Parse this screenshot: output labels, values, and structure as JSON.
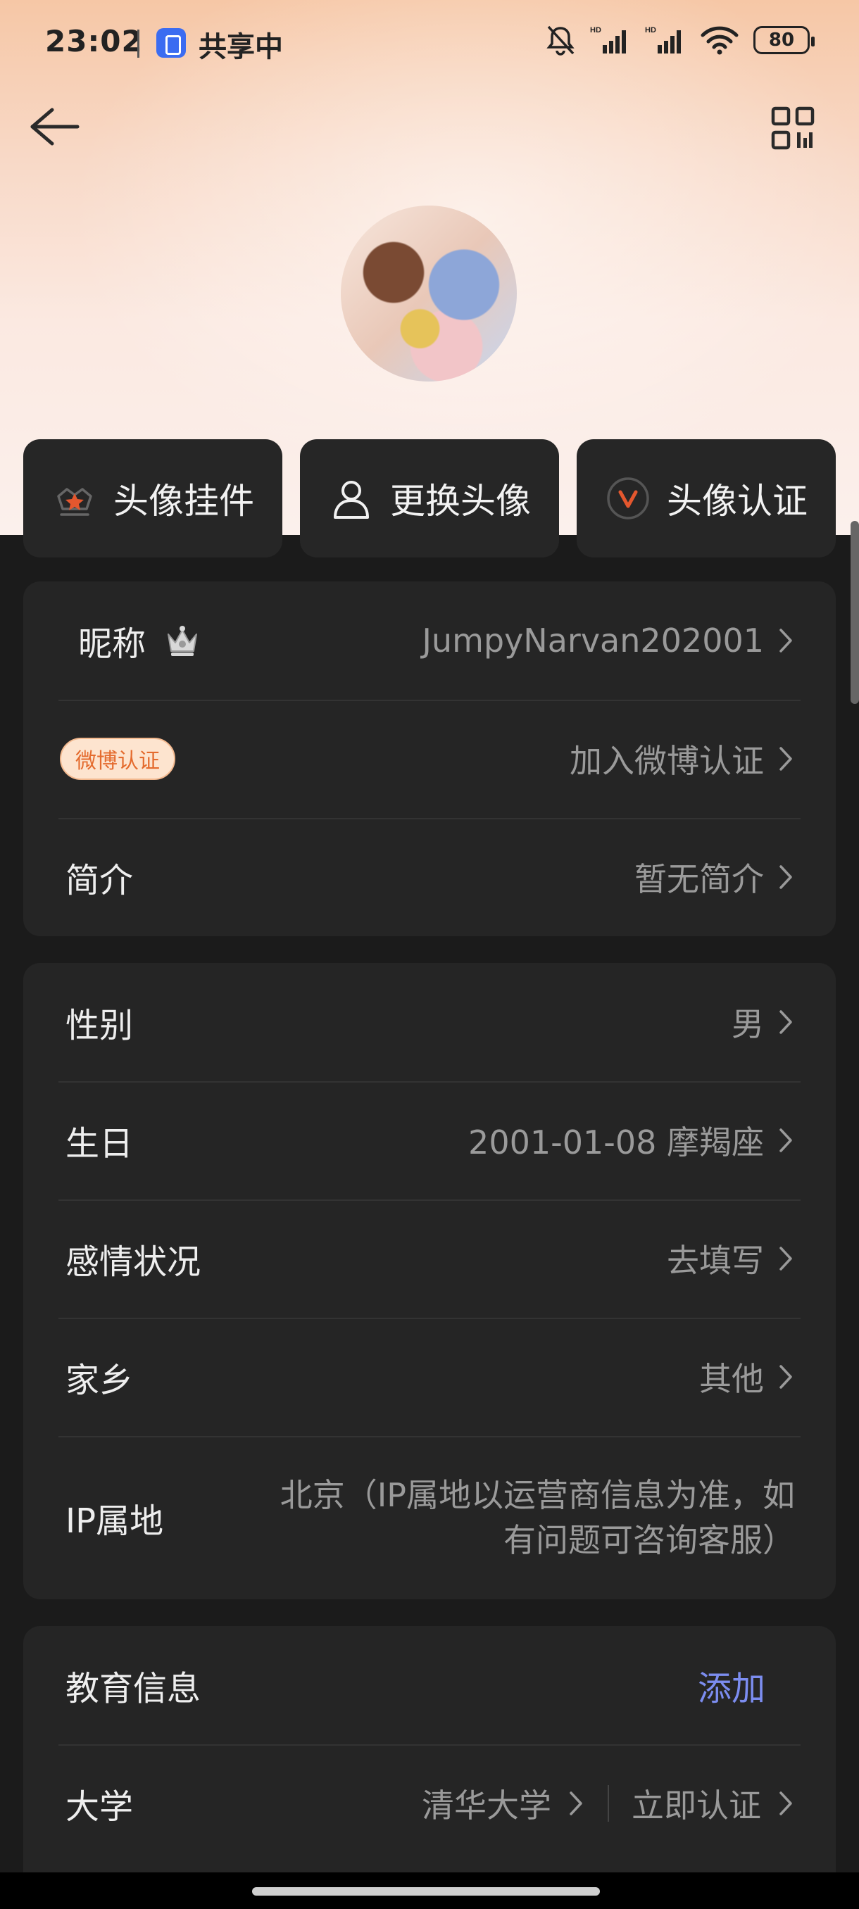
{
  "status_bar": {
    "time": "23:02",
    "share_label": "共享中",
    "battery": "80"
  },
  "action_buttons": [
    {
      "label": "头像挂件",
      "icon": "pendant-icon"
    },
    {
      "label": "更换头像",
      "icon": "person-icon"
    },
    {
      "label": "头像认证",
      "icon": "verified-v-icon"
    }
  ],
  "profile": {
    "nickname_label": "昵称",
    "nickname_value": "JumpyNarvan202001",
    "weibo_badge": "微博认证",
    "weibo_value": "加入微博认证",
    "bio_label": "简介",
    "bio_value": "暂无简介"
  },
  "personal": {
    "gender_label": "性别",
    "gender_value": "男",
    "birthday_label": "生日",
    "birthday_value": "2001-01-08 摩羯座",
    "relationship_label": "感情状况",
    "relationship_value": "去填写",
    "hometown_label": "家乡",
    "hometown_value": "其他",
    "ip_label": "IP属地",
    "ip_value": "北京（IP属地以运营商信息为准，如有问题可咨询客服）"
  },
  "education": {
    "title": "教育信息",
    "add_label": "添加",
    "university_label": "大学",
    "university_value": "清华大学",
    "verify_label": "立即认证"
  },
  "colors": {
    "background": "#1b1b1b",
    "card": "#252525",
    "link": "#7c8df0",
    "accent_orange": "#e4572e",
    "badge_bg": "#fde4cf"
  }
}
